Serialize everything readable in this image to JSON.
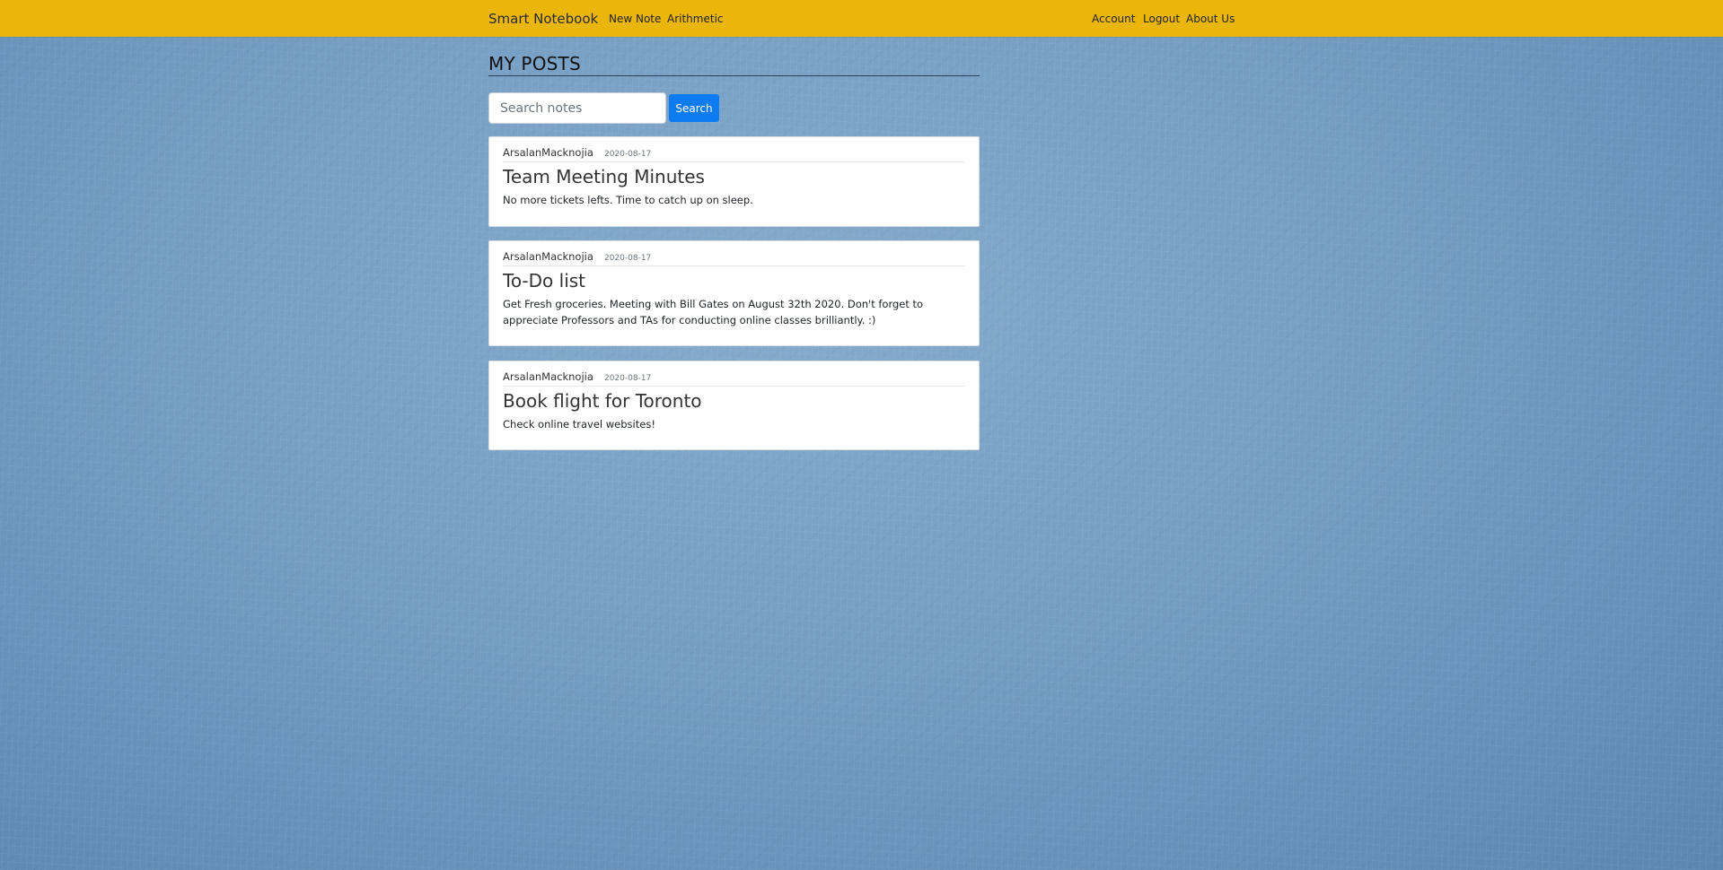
{
  "navbar": {
    "brand": "Smart Notebook",
    "left_links": [
      {
        "label": "New Note"
      },
      {
        "label": "Arithmetic"
      }
    ],
    "right_links": [
      {
        "label": "Account"
      },
      {
        "label": "Logout"
      },
      {
        "label": "About Us"
      }
    ]
  },
  "main": {
    "title": "MY POSTS",
    "search": {
      "placeholder": "Search notes",
      "value": "",
      "button_label": "Search"
    },
    "posts": [
      {
        "author": "ArsalanMacknojia",
        "date": "2020-08-17",
        "title": "Team Meeting Minutes",
        "content": "No more tickets lefts. Time to catch up on sleep."
      },
      {
        "author": "ArsalanMacknojia",
        "date": "2020-08-17",
        "title": "To-Do list",
        "content": "Get Fresh groceries. Meeting with Bill Gates on August 32th 2020. Don't forget to appreciate Professors and TAs for conducting online classes brilliantly. :)"
      },
      {
        "author": "ArsalanMacknojia",
        "date": "2020-08-17",
        "title": "Book flight for Toronto",
        "content": "Check online travel websites!"
      }
    ]
  },
  "colors": {
    "navbar_bg": "#eab60a",
    "search_button": "#0d7bf2",
    "page_background": "#6f97bc"
  }
}
